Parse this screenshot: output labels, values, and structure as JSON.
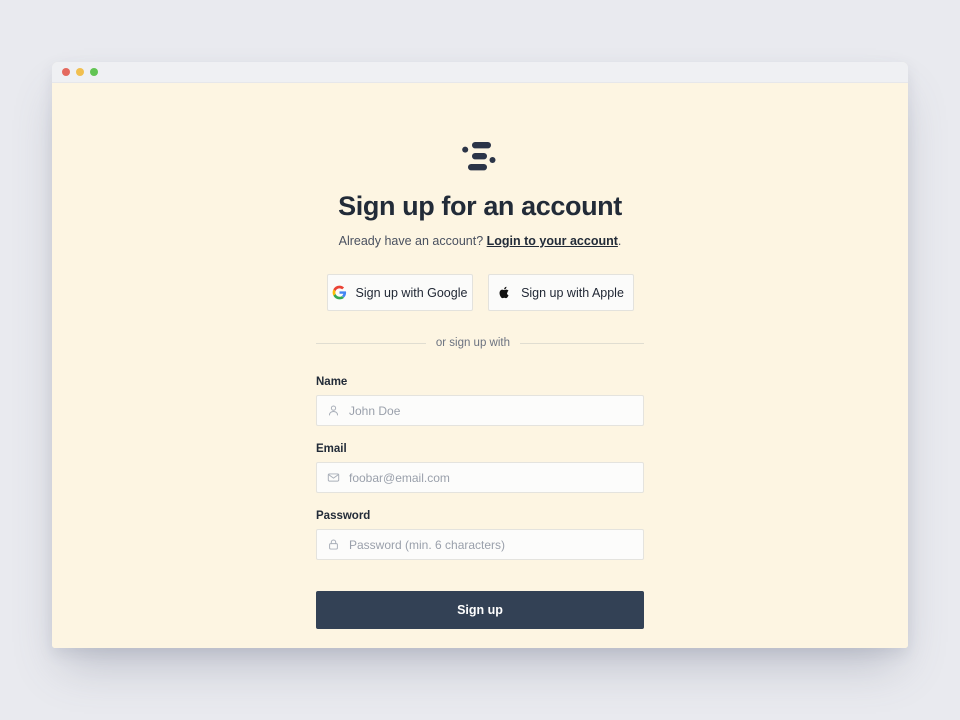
{
  "colors": {
    "page_background": "#e9eaef",
    "window_content_background": "#fdf5e2",
    "titlebar_background": "#eff0f3",
    "heading_text": "#222b38",
    "submit_button_background": "#334155",
    "submit_button_text": "#ffffff",
    "traffic_light_red": "#e4695e",
    "traffic_light_yellow": "#f1bf4f",
    "traffic_light_green": "#62c453",
    "divider_rule": "#e0ddd1",
    "input_border": "#e4e3de",
    "placeholder_text": "#9aa0ab"
  },
  "window": {
    "traffic_lights": [
      "close-button",
      "minimize-button",
      "zoom-button"
    ]
  },
  "brand": {
    "logo_icon": "stacked-bars-logo"
  },
  "header": {
    "title": "Sign up for an account",
    "subtitle_prefix": "Already have an account? ",
    "subtitle_link": "Login to your account",
    "subtitle_suffix": "."
  },
  "social": {
    "buttons": [
      {
        "label": "Sign up with Google",
        "icon": "google-icon"
      },
      {
        "label": "Sign up with Apple",
        "icon": "apple-icon"
      }
    ]
  },
  "divider": {
    "text": "or sign up with"
  },
  "form": {
    "fields": [
      {
        "label": "Name",
        "placeholder": "John Doe",
        "value": "",
        "icon": "user-icon",
        "type": "text"
      },
      {
        "label": "Email",
        "placeholder": "foobar@email.com",
        "value": "",
        "icon": "envelope-icon",
        "type": "email"
      },
      {
        "label": "Password",
        "placeholder": "Password (min. 6 characters)",
        "value": "",
        "icon": "lock-icon",
        "type": "password"
      }
    ],
    "submit_label": "Sign up"
  }
}
